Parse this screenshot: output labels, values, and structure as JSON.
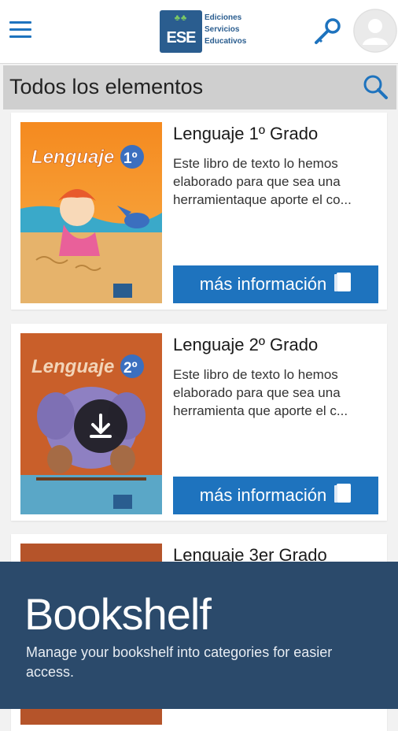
{
  "header": {
    "logo_mark": "ESE",
    "logo_lines": [
      "Ediciones",
      "Servicios",
      "Educativos"
    ],
    "menu_icon": "hamburger-menu-icon",
    "key_icon": "key-icon",
    "avatar_icon": "user-avatar-icon"
  },
  "section": {
    "title": "Todos los elementos",
    "search_icon": "search-icon"
  },
  "books": [
    {
      "title": "Lenguaje 1º Grado",
      "cover_label": "Lenguaje",
      "cover_grade": "1º",
      "description_lines": [
        "Este libro de texto lo hemos",
        "elaborado para que sea una",
        "herramientaque aporte el co..."
      ],
      "button_label": "más información"
    },
    {
      "title": "Lenguaje 2º Grado",
      "cover_label": "Lenguaje",
      "cover_grade": "2º",
      "description_lines": [
        "Este libro de texto lo hemos",
        "elaborado para que sea una",
        "herramienta que aporte el c..."
      ],
      "button_label": "más información"
    },
    {
      "title": "Lenguaje 3er Grado"
    }
  ],
  "overlay": {
    "title": "Bookshelf",
    "text": "Manage your bookshelf into categories for easier access."
  },
  "colors": {
    "accent": "#1e73be",
    "overlay": "#2b4a6b",
    "section_bg": "#cfcfcf"
  }
}
